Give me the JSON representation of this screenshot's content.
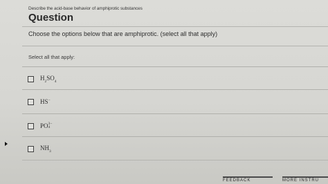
{
  "header": {
    "subtitle": "Describe the acid-base behavior of amphiprotic substances",
    "title": "Question"
  },
  "question": {
    "prompt": "Choose the options below that are amphiprotic. (select all that apply)",
    "select_label": "Select all that apply:"
  },
  "options": [
    {
      "main": "H",
      "sub1": "2",
      "mid": "SO",
      "sub2": "4",
      "sup": ""
    },
    {
      "main": "HS",
      "sub1": "",
      "mid": "",
      "sub2": "",
      "sup": "−"
    },
    {
      "main": "PO",
      "sub1": "",
      "mid": "",
      "sub2": "4",
      "sup": "3−"
    },
    {
      "main": "NH",
      "sub1": "",
      "mid": "",
      "sub2": "3",
      "sup": ""
    }
  ],
  "footer": {
    "feedback_label": "FEEDBACK",
    "more_label": "MORE INSTRU"
  }
}
